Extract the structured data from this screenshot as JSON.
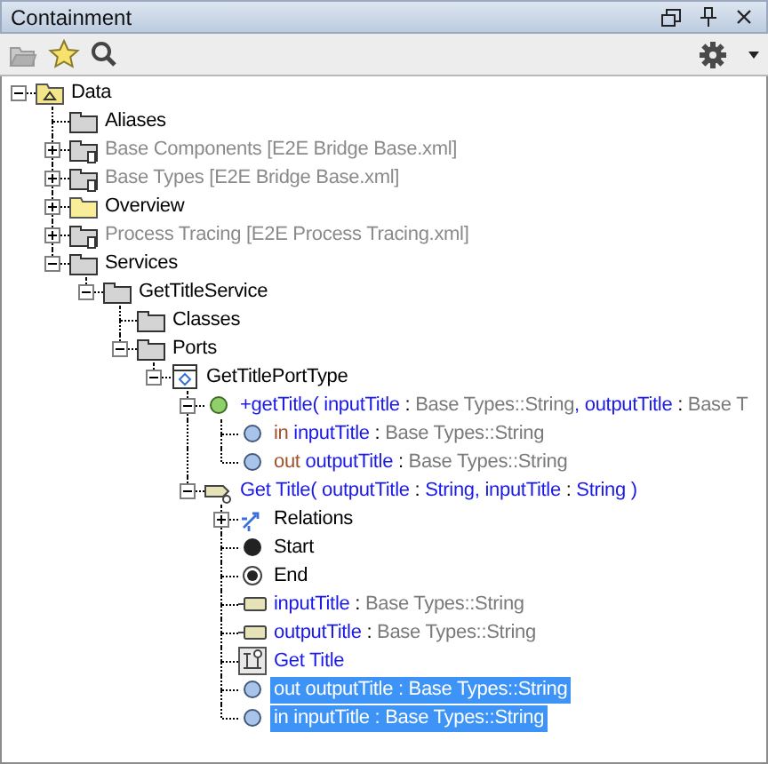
{
  "panel": {
    "title": "Containment"
  },
  "tree": [
    {
      "kind": "root-folder",
      "expanded": true,
      "selected": false,
      "label": [
        {
          "text": "Data",
          "kind": "text"
        }
      ],
      "children": [
        {
          "kind": "package",
          "selected": false,
          "label": [
            {
              "text": "Aliases",
              "kind": "text"
            }
          ]
        },
        {
          "kind": "package-ref",
          "expanded": false,
          "selected": false,
          "label": [
            {
              "text": "Base Components [E2E Bridge Base.xml]",
              "kind": "dim"
            }
          ]
        },
        {
          "kind": "package-ref",
          "expanded": false,
          "selected": false,
          "label": [
            {
              "text": "Base Types [E2E Bridge Base.xml]",
              "kind": "dim"
            }
          ]
        },
        {
          "kind": "folder",
          "expanded": false,
          "selected": false,
          "label": [
            {
              "text": "Overview",
              "kind": "text"
            }
          ]
        },
        {
          "kind": "package-ref",
          "expanded": false,
          "selected": false,
          "label": [
            {
              "text": "Process Tracing [E2E Process Tracing.xml]",
              "kind": "dim"
            }
          ]
        },
        {
          "kind": "package",
          "expanded": true,
          "selected": false,
          "label": [
            {
              "text": "Services",
              "kind": "text"
            }
          ],
          "children": [
            {
              "kind": "package",
              "expanded": true,
              "selected": false,
              "label": [
                {
                  "text": "GetTitleService",
                  "kind": "text"
                }
              ],
              "children": [
                {
                  "kind": "package",
                  "selected": false,
                  "label": [
                    {
                      "text": "Classes",
                      "kind": "text"
                    }
                  ]
                },
                {
                  "kind": "package",
                  "expanded": true,
                  "selected": false,
                  "label": [
                    {
                      "text": "Ports",
                      "kind": "text"
                    }
                  ],
                  "children": [
                    {
                      "kind": "port-type",
                      "expanded": true,
                      "selected": false,
                      "label": [
                        {
                          "text": "GetTitlePortType",
                          "kind": "text"
                        }
                      ],
                      "children": [
                        {
                          "kind": "operation",
                          "expanded": true,
                          "selected": false,
                          "label": [
                            {
                              "text": "+getTitle( inputTitle",
                              "kind": "name"
                            },
                            {
                              "text": " : ",
                              "kind": "text"
                            },
                            {
                              "text": "Base Types::String",
                              "kind": "type"
                            },
                            {
                              "text": ", outputTitle",
                              "kind": "name"
                            },
                            {
                              "text": " : ",
                              "kind": "text"
                            },
                            {
                              "text": "Base T",
                              "kind": "type"
                            }
                          ],
                          "children": [
                            {
                              "kind": "parameter",
                              "selected": false,
                              "label": [
                                {
                                  "text": "in ",
                                  "kind": "dir"
                                },
                                {
                                  "text": "inputTitle",
                                  "kind": "name"
                                },
                                {
                                  "text": " : ",
                                  "kind": "text"
                                },
                                {
                                  "text": "Base Types::String",
                                  "kind": "type"
                                }
                              ]
                            },
                            {
                              "kind": "parameter",
                              "selected": false,
                              "label": [
                                {
                                  "text": "out ",
                                  "kind": "dir"
                                },
                                {
                                  "text": "outputTitle",
                                  "kind": "name"
                                },
                                {
                                  "text": " : ",
                                  "kind": "text"
                                },
                                {
                                  "text": "Base Types::String",
                                  "kind": "type"
                                }
                              ]
                            }
                          ]
                        },
                        {
                          "kind": "activity",
                          "expanded": true,
                          "selected": false,
                          "label": [
                            {
                              "text": "Get Title( outputTitle",
                              "kind": "name"
                            },
                            {
                              "text": " : ",
                              "kind": "text"
                            },
                            {
                              "text": "String, inputTitle",
                              "kind": "name"
                            },
                            {
                              "text": " : ",
                              "kind": "text"
                            },
                            {
                              "text": "String )",
                              "kind": "name"
                            }
                          ],
                          "children": [
                            {
                              "kind": "relations",
                              "expanded": false,
                              "selected": false,
                              "label": [
                                {
                                  "text": "Relations",
                                  "kind": "text"
                                }
                              ]
                            },
                            {
                              "kind": "initial",
                              "selected": false,
                              "label": [
                                {
                                  "text": "Start",
                                  "kind": "text"
                                }
                              ]
                            },
                            {
                              "kind": "final",
                              "selected": false,
                              "label": [
                                {
                                  "text": "End",
                                  "kind": "text"
                                }
                              ]
                            },
                            {
                              "kind": "pin",
                              "selected": false,
                              "label": [
                                {
                                  "text": "inputTitle",
                                  "kind": "name"
                                },
                                {
                                  "text": " : ",
                                  "kind": "text"
                                },
                                {
                                  "text": "Base Types::String",
                                  "kind": "type"
                                }
                              ]
                            },
                            {
                              "kind": "pin",
                              "selected": false,
                              "label": [
                                {
                                  "text": "outputTitle",
                                  "kind": "name"
                                },
                                {
                                  "text": " : ",
                                  "kind": "text"
                                },
                                {
                                  "text": "Base Types::String",
                                  "kind": "type"
                                }
                              ]
                            },
                            {
                              "kind": "diagram",
                              "selected": false,
                              "label": [
                                {
                                  "text": "Get Title",
                                  "kind": "name"
                                }
                              ]
                            },
                            {
                              "kind": "parameter",
                              "selected": true,
                              "label": [
                                {
                                  "text": "out ",
                                  "kind": "dir"
                                },
                                {
                                  "text": "outputTitle",
                                  "kind": "name"
                                },
                                {
                                  "text": " : ",
                                  "kind": "text"
                                },
                                {
                                  "text": "Base Types::String",
                                  "kind": "type"
                                }
                              ]
                            },
                            {
                              "kind": "parameter",
                              "selected": true,
                              "label": [
                                {
                                  "text": "in ",
                                  "kind": "dir"
                                },
                                {
                                  "text": "inputTitle",
                                  "kind": "name"
                                },
                                {
                                  "text": " : ",
                                  "kind": "text"
                                },
                                {
                                  "text": "Base Types::String",
                                  "kind": "type"
                                }
                              ]
                            }
                          ]
                        }
                      ]
                    }
                  ]
                }
              ]
            }
          ]
        }
      ]
    }
  ]
}
